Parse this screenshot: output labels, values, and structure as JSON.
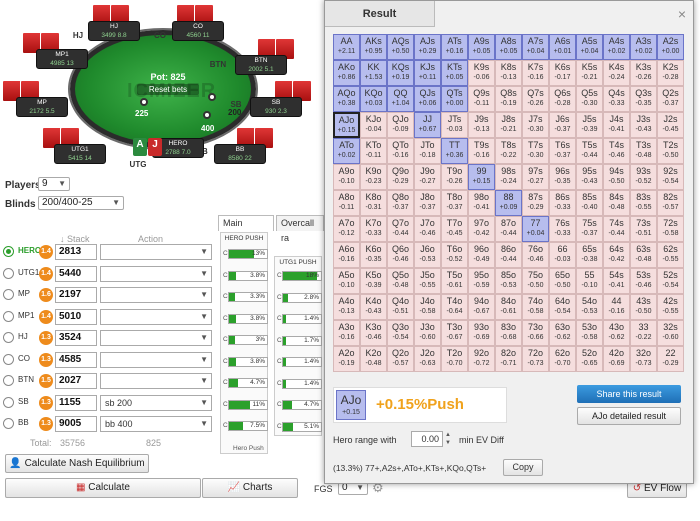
{
  "table": {
    "pot_label": "Pot: 825",
    "reset_label": "Reset bets",
    "watermark": "ICMIZER",
    "bets": [
      "225",
      "200",
      "400"
    ],
    "seats": [
      {
        "id": "hj",
        "name": "HJ",
        "stack": "3499",
        "bb": "8.8",
        "pos": "HJ"
      },
      {
        "id": "co",
        "name": "CO",
        "stack": "4560",
        "bb": "11",
        "pos": "CO"
      },
      {
        "id": "mp1",
        "name": "MP1",
        "stack": "4985",
        "bb": "13",
        "pos": "MP1"
      },
      {
        "id": "btn",
        "name": "BTN",
        "stack": "2002",
        "bb": "5.1",
        "pos": "BTN"
      },
      {
        "id": "mp",
        "name": "MP",
        "stack": "2172",
        "bb": "5.5",
        "pos": "MP"
      },
      {
        "id": "sb",
        "name": "SB",
        "stack": "930",
        "bb": "2.3",
        "pos": "SB"
      },
      {
        "id": "utg1",
        "name": "UTG1",
        "stack": "5415",
        "bb": "14",
        "pos": "UTG1"
      },
      {
        "id": "bb",
        "name": "BB",
        "stack": "8580",
        "bb": "22",
        "pos": "BB"
      },
      {
        "id": "hero",
        "name": "HERO",
        "stack": "2788",
        "bb": "7.0",
        "pos": "UTG"
      }
    ],
    "hero_cards": [
      {
        "rank": "A",
        "color": "#2b8a3e"
      },
      {
        "rank": "J",
        "color": "#c92a2a"
      }
    ]
  },
  "controls": {
    "players_label": "Players",
    "players_value": "9",
    "blinds_label": "Blinds",
    "blinds_value": "200/400-25",
    "stack_head": "Stack",
    "action_head": "Action"
  },
  "players": [
    {
      "pos": "HERO",
      "badge": "1.4",
      "stack": "2813",
      "action": "",
      "selected": true
    },
    {
      "pos": "UTG1",
      "badge": "1.4",
      "stack": "5440",
      "action": "",
      "selected": false
    },
    {
      "pos": "MP",
      "badge": "1.6",
      "stack": "2197",
      "action": "",
      "selected": false
    },
    {
      "pos": "MP1",
      "badge": "1.4",
      "stack": "5010",
      "action": "",
      "selected": false
    },
    {
      "pos": "HJ",
      "badge": "1.3",
      "stack": "3524",
      "action": "",
      "selected": false
    },
    {
      "pos": "CO",
      "badge": "1.3",
      "stack": "4585",
      "action": "",
      "selected": false
    },
    {
      "pos": "BTN",
      "badge": "1.5",
      "stack": "2027",
      "action": "",
      "selected": false
    },
    {
      "pos": "SB",
      "badge": "1.3",
      "stack": "1155",
      "action": "sb 200",
      "selected": false
    },
    {
      "pos": "BB",
      "badge": "1.3",
      "stack": "9005",
      "action": "bb 400",
      "selected": false
    }
  ],
  "totals": {
    "label": "Total:",
    "stack": "35756",
    "action": "825"
  },
  "buttons": {
    "nash": "Calculate Nash Equilibrium",
    "calculate": "Calculate",
    "charts": "Charts",
    "fgs_label": "FGS",
    "fgs_value": "0",
    "evflow": "EV Flow"
  },
  "ranges": {
    "tab_main": "Main ranges",
    "tab_overcall": "Overcall ra",
    "hero_push_title": "HERO PUSH",
    "utg1_push_title": "UTG1 PUSH",
    "hero_bars": [
      13,
      3.8,
      3.3,
      3.8,
      3,
      3.8,
      4.7,
      11,
      7.5
    ],
    "hero_bar_labels": [
      "13%",
      "3.8%",
      "3.3%",
      "3.8%",
      "3%",
      "3.8%",
      "4.7%",
      "11%",
      "7.5%"
    ],
    "utg1_bars": [
      18,
      2.8,
      1.4,
      1.7,
      1.4,
      1.4,
      4.7,
      5.1
    ],
    "utg1_bar_labels": [
      "18%",
      "2.8%",
      "1.4%",
      "1.7%",
      "1.4%",
      "1.4%",
      "4.7%",
      "5.1%"
    ],
    "bar_prefix": "C",
    "footer": "Hero Push"
  },
  "result": {
    "title": "Result",
    "close": "×",
    "selected_hand": "AJo",
    "selected_ev": "+0.15",
    "result_text": "+0.15%Push",
    "share_label": "Share this result",
    "detailed_label": "AJo detailed result",
    "hero_range_label": "Hero range with",
    "min_ev_value": "0.00",
    "min_ev_suffix": "min EV Diff",
    "range_text": "(13.3%) 77+,A2s+,ATo+,KTs+,KQo,QTs+",
    "copy_label": "Copy",
    "grid": [
      [
        "AA",
        "+2.11",
        "p2"
      ],
      [
        "AKs",
        "+0.95",
        "p2"
      ],
      [
        "AQs",
        "+0.50",
        "p2"
      ],
      [
        "AJs",
        "+0.29",
        "p2"
      ],
      [
        "ATs",
        "+0.16",
        "p2"
      ],
      [
        "A9s",
        "+0.05",
        "p2"
      ],
      [
        "A8s",
        "+0.05",
        "p2"
      ],
      [
        "A7s",
        "+0.04",
        "p2"
      ],
      [
        "A6s",
        "+0.01",
        "p2"
      ],
      [
        "A5s",
        "+0.04",
        "p2"
      ],
      [
        "A4s",
        "+0.02",
        "p2"
      ],
      [
        "A3s",
        "+0.02",
        "p2"
      ],
      [
        "A2s",
        "+0.00",
        "p2"
      ],
      [
        "AKo",
        "+0.86",
        "p2"
      ],
      [
        "KK",
        "+1.53",
        "p2"
      ],
      [
        "KQs",
        "+0.19",
        "p2"
      ],
      [
        "KJs",
        "+0.11",
        "p2"
      ],
      [
        "KTs",
        "+0.05",
        "p2"
      ],
      [
        "K9s",
        "-0.06",
        "f"
      ],
      [
        "K8s",
        "-0.13",
        "f"
      ],
      [
        "K7s",
        "-0.16",
        "f"
      ],
      [
        "K6s",
        "-0.17",
        "f"
      ],
      [
        "K5s",
        "-0.21",
        "f"
      ],
      [
        "K4s",
        "-0.24",
        "f"
      ],
      [
        "K3s",
        "-0.26",
        "f"
      ],
      [
        "K2s",
        "-0.28",
        "f"
      ],
      [
        "AQo",
        "+0.38",
        "p2"
      ],
      [
        "KQo",
        "+0.03",
        "p2"
      ],
      [
        "QQ",
        "+1.04",
        "p2"
      ],
      [
        "QJs",
        "+0.06",
        "p2"
      ],
      [
        "QTs",
        "+0.00",
        "p2"
      ],
      [
        "Q9s",
        "-0.11",
        "f"
      ],
      [
        "Q8s",
        "-0.19",
        "f"
      ],
      [
        "Q7s",
        "-0.26",
        "f"
      ],
      [
        "Q6s",
        "-0.28",
        "f"
      ],
      [
        "Q5s",
        "-0.30",
        "f"
      ],
      [
        "Q4s",
        "-0.33",
        "f"
      ],
      [
        "Q3s",
        "-0.35",
        "f"
      ],
      [
        "Q2s",
        "-0.37",
        "f"
      ],
      [
        "AJo",
        "+0.15",
        "sel"
      ],
      [
        "KJo",
        "-0.04",
        "f"
      ],
      [
        "QJo",
        "-0.09",
        "f"
      ],
      [
        "JJ",
        "+0.67",
        "p2"
      ],
      [
        "JTs",
        "-0.03",
        "f"
      ],
      [
        "J9s",
        "-0.13",
        "f"
      ],
      [
        "J8s",
        "-0.21",
        "f"
      ],
      [
        "J7s",
        "-0.30",
        "f"
      ],
      [
        "J6s",
        "-0.37",
        "f"
      ],
      [
        "J5s",
        "-0.39",
        "f"
      ],
      [
        "J4s",
        "-0.41",
        "f"
      ],
      [
        "J3s",
        "-0.43",
        "f"
      ],
      [
        "J2s",
        "-0.45",
        "f"
      ],
      [
        "ATo",
        "+0.02",
        "p2"
      ],
      [
        "KTo",
        "-0.11",
        "f"
      ],
      [
        "QTo",
        "-0.16",
        "f"
      ],
      [
        "JTo",
        "-0.18",
        "f"
      ],
      [
        "TT",
        "+0.36",
        "p2"
      ],
      [
        "T9s",
        "-0.16",
        "f"
      ],
      [
        "T8s",
        "-0.22",
        "f"
      ],
      [
        "T7s",
        "-0.30",
        "f"
      ],
      [
        "T6s",
        "-0.37",
        "f"
      ],
      [
        "T5s",
        "-0.44",
        "f"
      ],
      [
        "T4s",
        "-0.46",
        "f"
      ],
      [
        "T3s",
        "-0.48",
        "f"
      ],
      [
        "T2s",
        "-0.50",
        "f"
      ],
      [
        "A9o",
        "-0.10",
        "f"
      ],
      [
        "K9o",
        "-0.23",
        "f"
      ],
      [
        "Q9o",
        "-0.29",
        "f"
      ],
      [
        "J9o",
        "-0.27",
        "f"
      ],
      [
        "T9o",
        "-0.26",
        "f"
      ],
      [
        "99",
        "+0.15",
        "p1"
      ],
      [
        "98s",
        "-0.24",
        "f"
      ],
      [
        "97s",
        "-0.27",
        "f"
      ],
      [
        "96s",
        "-0.35",
        "f"
      ],
      [
        "95s",
        "-0.43",
        "f"
      ],
      [
        "94s",
        "-0.50",
        "f"
      ],
      [
        "93s",
        "-0.52",
        "f"
      ],
      [
        "92s",
        "-0.54",
        "f"
      ],
      [
        "A8o",
        "-0.11",
        "f"
      ],
      [
        "K8o",
        "-0.31",
        "f"
      ],
      [
        "Q8o",
        "-0.37",
        "f"
      ],
      [
        "J8o",
        "-0.37",
        "f"
      ],
      [
        "T8o",
        "-0.37",
        "f"
      ],
      [
        "98o",
        "-0.41",
        "f"
      ],
      [
        "88",
        "+0.09",
        "p1"
      ],
      [
        "87s",
        "-0.29",
        "f"
      ],
      [
        "86s",
        "-0.33",
        "f"
      ],
      [
        "85s",
        "-0.40",
        "f"
      ],
      [
        "84s",
        "-0.48",
        "f"
      ],
      [
        "83s",
        "-0.55",
        "f"
      ],
      [
        "82s",
        "-0.57",
        "f"
      ],
      [
        "A7o",
        "-0.12",
        "f"
      ],
      [
        "K7o",
        "-0.33",
        "f"
      ],
      [
        "Q7o",
        "-0.44",
        "f"
      ],
      [
        "J7o",
        "-0.46",
        "f"
      ],
      [
        "T7o",
        "-0.45",
        "f"
      ],
      [
        "97o",
        "-0.42",
        "f"
      ],
      [
        "87o",
        "-0.44",
        "f"
      ],
      [
        "77",
        "+0.04",
        "p1"
      ],
      [
        "76s",
        "-0.33",
        "f"
      ],
      [
        "75s",
        "-0.37",
        "f"
      ],
      [
        "74s",
        "-0.44",
        "f"
      ],
      [
        "73s",
        "-0.51",
        "f"
      ],
      [
        "72s",
        "-0.58",
        "f"
      ],
      [
        "A6o",
        "-0.16",
        "f"
      ],
      [
        "K6o",
        "-0.35",
        "f"
      ],
      [
        "Q6o",
        "-0.46",
        "f"
      ],
      [
        "J6o",
        "-0.53",
        "f"
      ],
      [
        "T6o",
        "-0.52",
        "f"
      ],
      [
        "96o",
        "-0.49",
        "f"
      ],
      [
        "86o",
        "-0.44",
        "f"
      ],
      [
        "76o",
        "-0.46",
        "f"
      ],
      [
        "66",
        "-0.03",
        "f"
      ],
      [
        "65s",
        "-0.38",
        "f"
      ],
      [
        "64s",
        "-0.42",
        "f"
      ],
      [
        "63s",
        "-0.48",
        "f"
      ],
      [
        "62s",
        "-0.55",
        "f"
      ],
      [
        "A5o",
        "-0.10",
        "f"
      ],
      [
        "K5o",
        "-0.39",
        "f"
      ],
      [
        "Q5o",
        "-0.48",
        "f"
      ],
      [
        "J5o",
        "-0.55",
        "f"
      ],
      [
        "T5o",
        "-0.61",
        "f"
      ],
      [
        "95o",
        "-0.59",
        "f"
      ],
      [
        "85o",
        "-0.53",
        "f"
      ],
      [
        "75o",
        "-0.50",
        "f"
      ],
      [
        "65o",
        "-0.50",
        "f"
      ],
      [
        "55",
        "-0.10",
        "f"
      ],
      [
        "54s",
        "-0.41",
        "f"
      ],
      [
        "53s",
        "-0.46",
        "f"
      ],
      [
        "52s",
        "-0.54",
        "f"
      ],
      [
        "A4o",
        "-0.13",
        "f"
      ],
      [
        "K4o",
        "-0.43",
        "f"
      ],
      [
        "Q4o",
        "-0.51",
        "f"
      ],
      [
        "J4o",
        "-0.58",
        "f"
      ],
      [
        "T4o",
        "-0.64",
        "f"
      ],
      [
        "94o",
        "-0.67",
        "f"
      ],
      [
        "84o",
        "-0.61",
        "f"
      ],
      [
        "74o",
        "-0.58",
        "f"
      ],
      [
        "64o",
        "-0.54",
        "f"
      ],
      [
        "54o",
        "-0.53",
        "f"
      ],
      [
        "44",
        "-0.16",
        "f"
      ],
      [
        "43s",
        "-0.50",
        "f"
      ],
      [
        "42s",
        "-0.55",
        "f"
      ],
      [
        "A3o",
        "-0.16",
        "f"
      ],
      [
        "K3o",
        "-0.46",
        "f"
      ],
      [
        "Q3o",
        "-0.54",
        "f"
      ],
      [
        "J3o",
        "-0.60",
        "f"
      ],
      [
        "T3o",
        "-0.67",
        "f"
      ],
      [
        "93o",
        "-0.69",
        "f"
      ],
      [
        "83o",
        "-0.68",
        "f"
      ],
      [
        "73o",
        "-0.66",
        "f"
      ],
      [
        "63o",
        "-0.62",
        "f"
      ],
      [
        "53o",
        "-0.58",
        "f"
      ],
      [
        "43o",
        "-0.62",
        "f"
      ],
      [
        "33",
        "-0.22",
        "f"
      ],
      [
        "32s",
        "-0.60",
        "f"
      ],
      [
        "A2o",
        "-0.19",
        "f"
      ],
      [
        "K2o",
        "-0.48",
        "f"
      ],
      [
        "Q2o",
        "-0.57",
        "f"
      ],
      [
        "J2o",
        "-0.63",
        "f"
      ],
      [
        "T2o",
        "-0.70",
        "f"
      ],
      [
        "92o",
        "-0.72",
        "f"
      ],
      [
        "82o",
        "-0.71",
        "f"
      ],
      [
        "72o",
        "-0.73",
        "f"
      ],
      [
        "62o",
        "-0.70",
        "f"
      ],
      [
        "52o",
        "-0.65",
        "f"
      ],
      [
        "42o",
        "-0.69",
        "f"
      ],
      [
        "32o",
        "-0.73",
        "f"
      ],
      [
        "22",
        "-0.29",
        "f"
      ]
    ]
  },
  "colors": {
    "push": "#b7bdee",
    "push_strong": "#6f7fd8",
    "fold": "#f5dede",
    "result_orange": "#f0a21c",
    "hero_green": "#2b9e2b"
  }
}
